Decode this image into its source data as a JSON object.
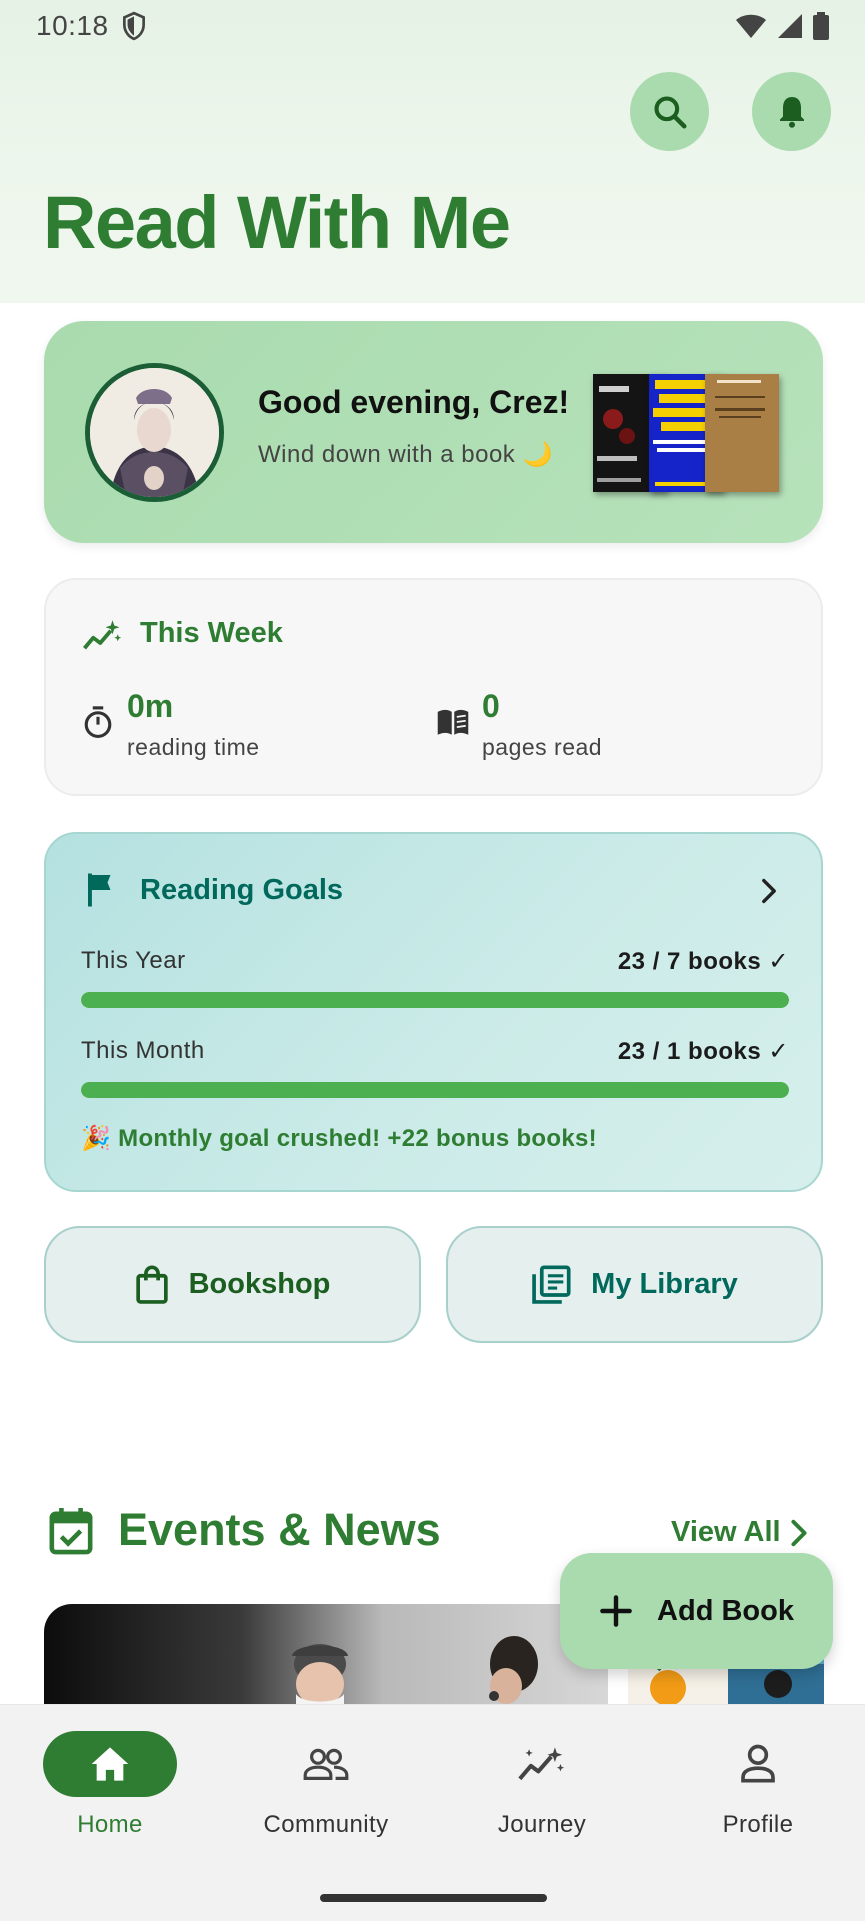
{
  "status_bar": {
    "time": "10:18"
  },
  "header": {
    "title": "Read With Me"
  },
  "greeting": {
    "title": "Good evening, Crez!",
    "subtitle": "Wind down with a book 🌙"
  },
  "this_week": {
    "title": "This Week",
    "reading_time_value": "0m",
    "reading_time_label": "reading time",
    "pages_value": "0",
    "pages_label": "pages read"
  },
  "goals": {
    "title": "Reading Goals",
    "year_label": "This Year",
    "year_value": "23 / 7 books ✓",
    "year_progress": 1.0,
    "month_label": "This Month",
    "month_value": "23 / 1 books ✓",
    "month_progress": 1.0,
    "message": "🎉 Monthly goal crushed! +22 bonus books!"
  },
  "quick_actions": {
    "bookshop": "Bookshop",
    "library": "My Library"
  },
  "events": {
    "title": "Events & News",
    "view_all": "View All"
  },
  "fab": {
    "label": "Add Book"
  },
  "nav": {
    "home": "Home",
    "community": "Community",
    "journey": "Journey",
    "profile": "Profile"
  },
  "colors": {
    "primary": "#2e7d32",
    "accent_light": "#a9dbae",
    "teal": "#00695c"
  }
}
